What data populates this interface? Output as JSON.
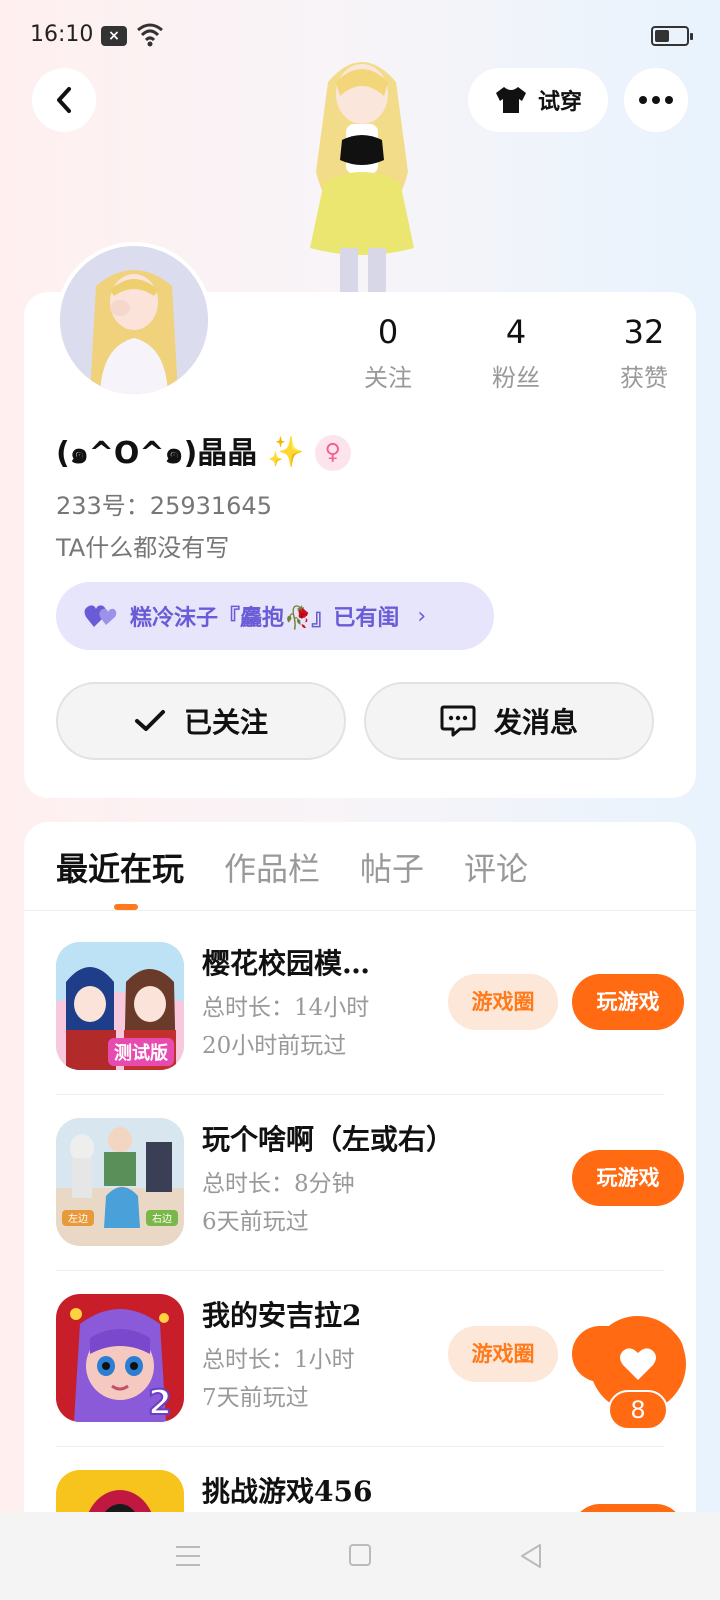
{
  "status_bar": {
    "time": "16:10",
    "notification_badge": "×"
  },
  "header": {
    "tryon_label": "试穿"
  },
  "profile": {
    "stats": [
      {
        "value": "0",
        "label": "关注"
      },
      {
        "value": "4",
        "label": "粉丝"
      },
      {
        "value": "32",
        "label": "获赞"
      }
    ],
    "nickname": "(๑^O^๑)晶晶",
    "gender_symbol": "♀",
    "user_id": "233号：25931645",
    "bio": "TA什么都没有写",
    "cp_banner": "糕冷沫子『麤抱🥀』已有闺",
    "follow_label": "已关注",
    "message_label": "发消息"
  },
  "tabs": [
    {
      "label": "最近在玩",
      "active": true
    },
    {
      "label": "作品栏",
      "active": false
    },
    {
      "label": "帖子",
      "active": false
    },
    {
      "label": "评论",
      "active": false
    }
  ],
  "games": [
    {
      "title": "樱花校园模…",
      "duration": "总时长：14小时",
      "last_played": "20小时前玩过",
      "circle_label": "游戏圈",
      "play_label": "玩游戏",
      "icon_badge": "测试版"
    },
    {
      "title": "玩个啥啊（左或右）",
      "duration": "总时长：8分钟",
      "last_played": "6天前玩过",
      "play_label": "玩游戏",
      "icon_left": "左边",
      "icon_right": "右边"
    },
    {
      "title": "我的安吉拉2",
      "duration": "总时长：1小时",
      "last_played": "7天前玩过",
      "circle_label": "游戏圈",
      "play_label": "玩游戏",
      "icon_badge": "2"
    },
    {
      "title": "挑战游戏456"
    }
  ],
  "like_fab": {
    "count": "8"
  },
  "colors": {
    "accent": "#ff6a12",
    "cp_purple": "#6a5bd6",
    "gender_pink": "#f06292"
  }
}
